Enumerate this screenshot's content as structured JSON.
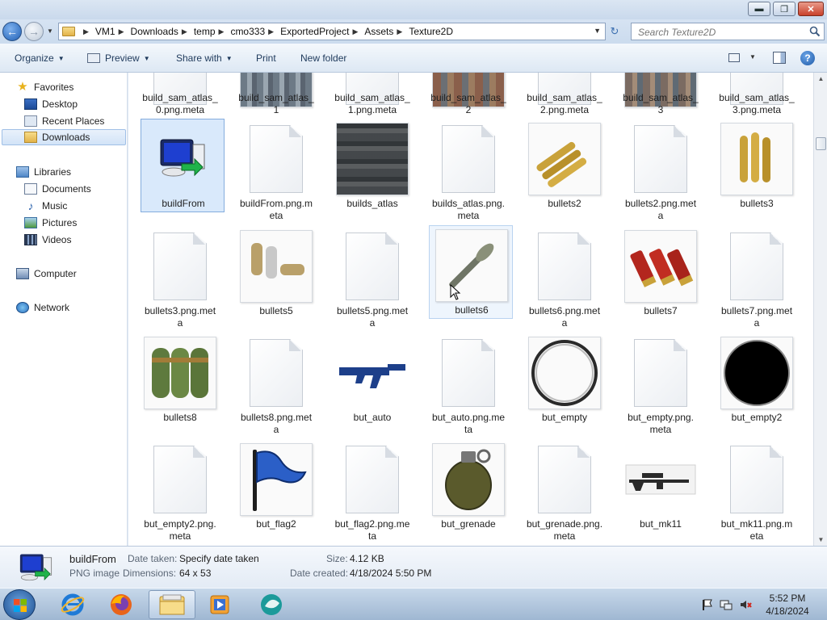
{
  "window": {
    "minimize": "▬",
    "maximize": "❐",
    "close": "✕"
  },
  "address": {
    "crumbs": [
      "VM1",
      "Downloads",
      "temp",
      "cmo333",
      "ExportedProject",
      "Assets",
      "Texture2D"
    ],
    "search_placeholder": "Search Texture2D"
  },
  "toolbar": {
    "organize": "Organize",
    "preview": "Preview",
    "share_with": "Share with",
    "print": "Print",
    "new_folder": "New folder",
    "help": "?"
  },
  "nav": {
    "favorites": "Favorites",
    "desktop": "Desktop",
    "recent_places": "Recent Places",
    "downloads": "Downloads",
    "libraries": "Libraries",
    "documents": "Documents",
    "music": "Music",
    "pictures": "Pictures",
    "videos": "Videos",
    "computer": "Computer",
    "network": "Network"
  },
  "files": {
    "r0": [
      "build_sam_atlas_\n0.png.meta",
      "build_sam_atlas_\n1",
      "build_sam_atlas_\n1.png.meta",
      "build_sam_atlas_\n2",
      "build_sam_atlas_\n2.png.meta",
      "build_sam_atlas_\n3",
      "build_sam_atlas_\n3.png.meta"
    ],
    "r1": [
      "buildFrom",
      "buildFrom.png.m\neta",
      "builds_atlas",
      "builds_atlas.png.\nmeta",
      "bullets2",
      "bullets2.png.met\na",
      "bullets3"
    ],
    "r2": [
      "bullets3.png.met\na",
      "bullets5",
      "bullets5.png.met\na",
      "bullets6",
      "bullets6.png.met\na",
      "bullets7",
      "bullets7.png.met\na"
    ],
    "r3": [
      "bullets8",
      "bullets8.png.met\na",
      "but_auto",
      "but_auto.png.me\nta",
      "but_empty",
      "but_empty.png.\nmeta",
      "but_empty2"
    ],
    "r4": [
      "but_empty2.png.\nmeta",
      "but_flag2",
      "but_flag2.png.me\nta",
      "but_grenade",
      "but_grenade.png.\nmeta",
      "but_mk11",
      "but_mk11.png.m\neta"
    ]
  },
  "details": {
    "name": "buildFrom",
    "type": "PNG image",
    "date_taken_label": "Date taken:",
    "date_taken": "Specify date taken",
    "dimensions_label": "Dimensions:",
    "dimensions": "64 x 53",
    "size_label": "Size:",
    "size": "4.12 KB",
    "date_created_label": "Date created:",
    "date_created": "4/18/2024 5:50 PM"
  },
  "clock": {
    "time": "5:52 PM",
    "date": "4/18/2024"
  },
  "colors": {
    "selection": "#d9e9fb",
    "accent": "#1c4e8f"
  }
}
